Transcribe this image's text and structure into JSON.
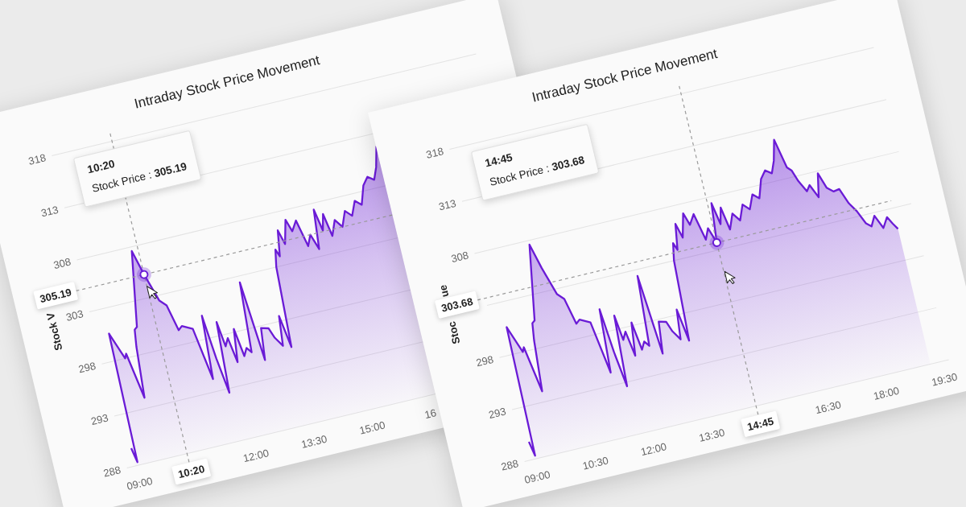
{
  "cards": [
    {
      "title": "Intraday Stock Price Movement",
      "y_axis_labels": [
        "318",
        "313",
        "308",
        "303",
        "298",
        "293",
        "288"
      ],
      "x_axis_labels": [
        "09:00",
        "12:00",
        "13:30",
        "15:00",
        "16"
      ],
      "y_axis_title_parts": [
        "Stock V"
      ],
      "tooltip": {
        "heading": "10:20",
        "text": "Stock Price : **305.19**"
      },
      "crosshair": {
        "time_label": "10:20",
        "value_label": "305.19"
      }
    },
    {
      "title": "Intraday Stock Price Movement",
      "y_axis_labels": [
        "318",
        "313",
        "308",
        "298",
        "293",
        "288"
      ],
      "x_axis_labels": [
        "09:00",
        "10:30",
        "12:00",
        "13:30",
        "16:30",
        "18:00",
        "19:30"
      ],
      "y_axis_title_parts": [
        "Stoc",
        "ue"
      ],
      "tooltip": {
        "heading": "14:45",
        "text": "Stock Price : **303.68**"
      },
      "crosshair": {
        "time_label": "14:45",
        "value_label": "303.68"
      }
    }
  ]
}
